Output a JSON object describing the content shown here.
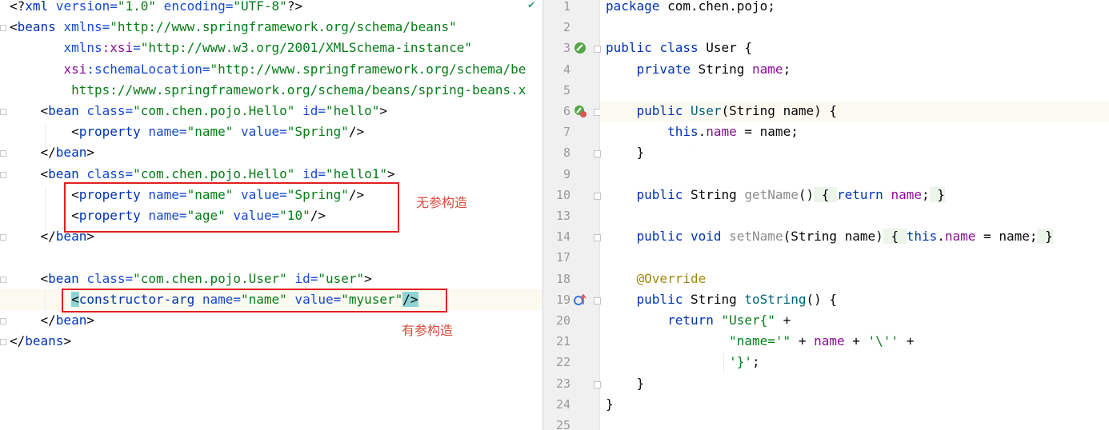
{
  "xml_editor": {
    "lines": [
      [
        {
          "t": "<?",
          "c": "punct"
        },
        {
          "t": "xml",
          "c": "tag"
        },
        {
          "t": " version=",
          "c": "attr"
        },
        {
          "t": "\"1.0\"",
          "c": "str"
        },
        {
          "t": " encoding=",
          "c": "attr"
        },
        {
          "t": "\"UTF-8\"",
          "c": "str"
        },
        {
          "t": "?>",
          "c": "punct"
        }
      ],
      [
        {
          "t": "<",
          "c": "punct"
        },
        {
          "t": "beans",
          "c": "tag"
        },
        {
          "t": " xmlns=",
          "c": "attr"
        },
        {
          "t": "\"http://www.springframework.org/schema/beans\"",
          "c": "str"
        }
      ],
      [
        {
          "t": "       ",
          "c": "plain"
        },
        {
          "t": "xmlns",
          "c": "attr"
        },
        {
          "t": ":xsi",
          "c": "ns"
        },
        {
          "t": "=",
          "c": "attr"
        },
        {
          "t": "\"http://www.w3.org/2001/XMLSchema-instance\"",
          "c": "str"
        }
      ],
      [
        {
          "t": "       ",
          "c": "plain"
        },
        {
          "t": "xsi",
          "c": "ns"
        },
        {
          "t": ":schemaLocation=",
          "c": "attr"
        },
        {
          "t": "\"http://www.springframework.org/schema/be",
          "c": "str"
        }
      ],
      [
        {
          "t": "        https://www.springframework.org/schema/beans/spring-beans.x",
          "c": "str"
        }
      ],
      [
        {
          "t": "    <",
          "c": "punct"
        },
        {
          "t": "bean",
          "c": "tag"
        },
        {
          "t": " class=",
          "c": "attr"
        },
        {
          "t": "\"com.chen.pojo.Hello\"",
          "c": "str"
        },
        {
          "t": " id=",
          "c": "attr"
        },
        {
          "t": "\"hello\"",
          "c": "str"
        },
        {
          "t": ">",
          "c": "punct"
        }
      ],
      [
        {
          "t": "        <",
          "c": "punct"
        },
        {
          "t": "property",
          "c": "tag"
        },
        {
          "t": " name=",
          "c": "attr"
        },
        {
          "t": "\"name\"",
          "c": "str"
        },
        {
          "t": " value=",
          "c": "attr"
        },
        {
          "t": "\"Spring\"",
          "c": "str"
        },
        {
          "t": "/>",
          "c": "punct"
        }
      ],
      [
        {
          "t": "    </",
          "c": "punct"
        },
        {
          "t": "bean",
          "c": "tag"
        },
        {
          "t": ">",
          "c": "punct"
        }
      ],
      [
        {
          "t": "    <",
          "c": "punct"
        },
        {
          "t": "bean",
          "c": "tag"
        },
        {
          "t": " class=",
          "c": "attr"
        },
        {
          "t": "\"com.chen.pojo.Hello\"",
          "c": "str"
        },
        {
          "t": " id=",
          "c": "attr"
        },
        {
          "t": "\"hello1\"",
          "c": "str"
        },
        {
          "t": ">",
          "c": "punct"
        }
      ],
      [
        {
          "t": "        <",
          "c": "punct"
        },
        {
          "t": "property",
          "c": "tag"
        },
        {
          "t": " name=",
          "c": "attr"
        },
        {
          "t": "\"name\"",
          "c": "str"
        },
        {
          "t": " value=",
          "c": "attr"
        },
        {
          "t": "\"Spring\"",
          "c": "str"
        },
        {
          "t": "/>",
          "c": "punct"
        }
      ],
      [
        {
          "t": "        <",
          "c": "punct"
        },
        {
          "t": "property",
          "c": "tag"
        },
        {
          "t": " name=",
          "c": "attr"
        },
        {
          "t": "\"age\"",
          "c": "str"
        },
        {
          "t": " value=",
          "c": "attr"
        },
        {
          "t": "\"10\"",
          "c": "str"
        },
        {
          "t": "/>",
          "c": "punct"
        }
      ],
      [
        {
          "t": "    </",
          "c": "punct"
        },
        {
          "t": "bean",
          "c": "tag"
        },
        {
          "t": ">",
          "c": "punct"
        }
      ],
      [],
      [
        {
          "t": "    <",
          "c": "punct"
        },
        {
          "t": "bean",
          "c": "tag"
        },
        {
          "t": " class=",
          "c": "attr"
        },
        {
          "t": "\"com.chen.pojo.User\"",
          "c": "str"
        },
        {
          "t": " id=",
          "c": "attr"
        },
        {
          "t": "\"user\"",
          "c": "str"
        },
        {
          "t": ">",
          "c": "punct"
        }
      ],
      [
        {
          "t": "        ",
          "c": "plain"
        },
        {
          "t": "<",
          "c": "cyan"
        },
        {
          "t": "constructor-arg",
          "c": "tag"
        },
        {
          "t": " name=",
          "c": "attr"
        },
        {
          "t": "\"name\"",
          "c": "str"
        },
        {
          "t": " value=",
          "c": "attr"
        },
        {
          "t": "\"myuser\"",
          "c": "str"
        },
        {
          "t": "/>",
          "c": "cyan"
        }
      ],
      [
        {
          "t": "    </",
          "c": "punct"
        },
        {
          "t": "bean",
          "c": "tag"
        },
        {
          "t": ">",
          "c": "punct"
        }
      ],
      [
        {
          "t": "</",
          "c": "punct"
        },
        {
          "t": "beans",
          "c": "tag"
        },
        {
          "t": ">",
          "c": "punct"
        }
      ]
    ],
    "annotations": {
      "no_arg_constructor": "无参构造",
      "arg_constructor": "有参构造"
    },
    "inspection_icon": "check-icon"
  },
  "java_editor": {
    "line_numbers": [
      "1",
      "2",
      "3",
      "4",
      "5",
      "6",
      "7",
      "8",
      "9",
      "10",
      "13",
      "14",
      "17",
      "18",
      "19",
      "20",
      "21",
      "22",
      "23",
      "24",
      "25"
    ],
    "lines": [
      [
        {
          "t": "package",
          "c": "kw"
        },
        {
          "t": " com.chen.pojo;",
          "c": "plain"
        }
      ],
      [],
      [
        {
          "t": "public",
          "c": "kw"
        },
        {
          "t": " ",
          "c": "plain"
        },
        {
          "t": "class",
          "c": "kw"
        },
        {
          "t": " User {",
          "c": "plain"
        }
      ],
      [
        {
          "t": "    ",
          "c": "plain"
        },
        {
          "t": "private",
          "c": "kw"
        },
        {
          "t": " String ",
          "c": "plain"
        },
        {
          "t": "name",
          "c": "field"
        },
        {
          "t": ";",
          "c": "plain"
        }
      ],
      [],
      [
        {
          "t": "    ",
          "c": "plain"
        },
        {
          "t": "public",
          "c": "kw"
        },
        {
          "t": " ",
          "c": "plain"
        },
        {
          "t": "User",
          "c": "fn"
        },
        {
          "t": "(String name) {",
          "c": "plain"
        }
      ],
      [
        {
          "t": "        ",
          "c": "plain"
        },
        {
          "t": "this",
          "c": "kw"
        },
        {
          "t": ".",
          "c": "plain"
        },
        {
          "t": "name",
          "c": "field"
        },
        {
          "t": " = name;",
          "c": "plain"
        }
      ],
      [
        {
          "t": "    }",
          "c": "plain"
        }
      ],
      [],
      [
        {
          "t": "    ",
          "c": "plain"
        },
        {
          "t": "public",
          "c": "kw"
        },
        {
          "t": " String ",
          "c": "plain"
        },
        {
          "t": "getName",
          "c": "fold"
        },
        {
          "t": "()",
          "c": "plain"
        },
        {
          "t": " { ",
          "c": "box"
        },
        {
          "t": "return",
          "c": "kw"
        },
        {
          "t": " ",
          "c": "plain"
        },
        {
          "t": "name",
          "c": "field"
        },
        {
          "t": ";",
          "c": "plain"
        },
        {
          "t": " }",
          "c": "box"
        }
      ],
      [],
      [
        {
          "t": "    ",
          "c": "plain"
        },
        {
          "t": "public",
          "c": "kw"
        },
        {
          "t": " ",
          "c": "plain"
        },
        {
          "t": "void",
          "c": "kw"
        },
        {
          "t": " ",
          "c": "plain"
        },
        {
          "t": "setName",
          "c": "fold"
        },
        {
          "t": "(String name)",
          "c": "plain"
        },
        {
          "t": " { ",
          "c": "box"
        },
        {
          "t": "this",
          "c": "kw"
        },
        {
          "t": ".",
          "c": "plain"
        },
        {
          "t": "name",
          "c": "field"
        },
        {
          "t": " = name;",
          "c": "plain"
        },
        {
          "t": " }",
          "c": "box"
        }
      ],
      [],
      [
        {
          "t": "    ",
          "c": "plain"
        },
        {
          "t": "@Override",
          "c": "ann"
        }
      ],
      [
        {
          "t": "    ",
          "c": "plain"
        },
        {
          "t": "public",
          "c": "kw"
        },
        {
          "t": " String ",
          "c": "plain"
        },
        {
          "t": "toString",
          "c": "fn"
        },
        {
          "t": "() {",
          "c": "plain"
        }
      ],
      [
        {
          "t": "        ",
          "c": "plain"
        },
        {
          "t": "return",
          "c": "kw"
        },
        {
          "t": " ",
          "c": "plain"
        },
        {
          "t": "\"User{\"",
          "c": "str"
        },
        {
          "t": " +",
          "c": "plain"
        }
      ],
      [
        {
          "t": "                ",
          "c": "plain"
        },
        {
          "t": "\"name='\"",
          "c": "str"
        },
        {
          "t": " + ",
          "c": "plain"
        },
        {
          "t": "name",
          "c": "field"
        },
        {
          "t": " + ",
          "c": "plain"
        },
        {
          "t": "'\\''",
          "c": "str"
        },
        {
          "t": " +",
          "c": "plain"
        }
      ],
      [
        {
          "t": "                ",
          "c": "plain"
        },
        {
          "t": "'}'",
          "c": "str"
        },
        {
          "t": ";",
          "c": "plain"
        }
      ],
      [
        {
          "t": "    }",
          "c": "plain"
        }
      ],
      [
        {
          "t": "}",
          "c": "plain"
        }
      ],
      []
    ],
    "gutter_icons": {
      "2": "class-bean-icon",
      "5": "constructor-bean-icon",
      "14": "override-method-icon"
    },
    "highlighted_line_index": 5,
    "colors": {
      "keyword": "#0033b3",
      "string": "#067d17",
      "field": "#871094",
      "annotation": "#9e880d",
      "annotation_red": "#e02020"
    }
  }
}
